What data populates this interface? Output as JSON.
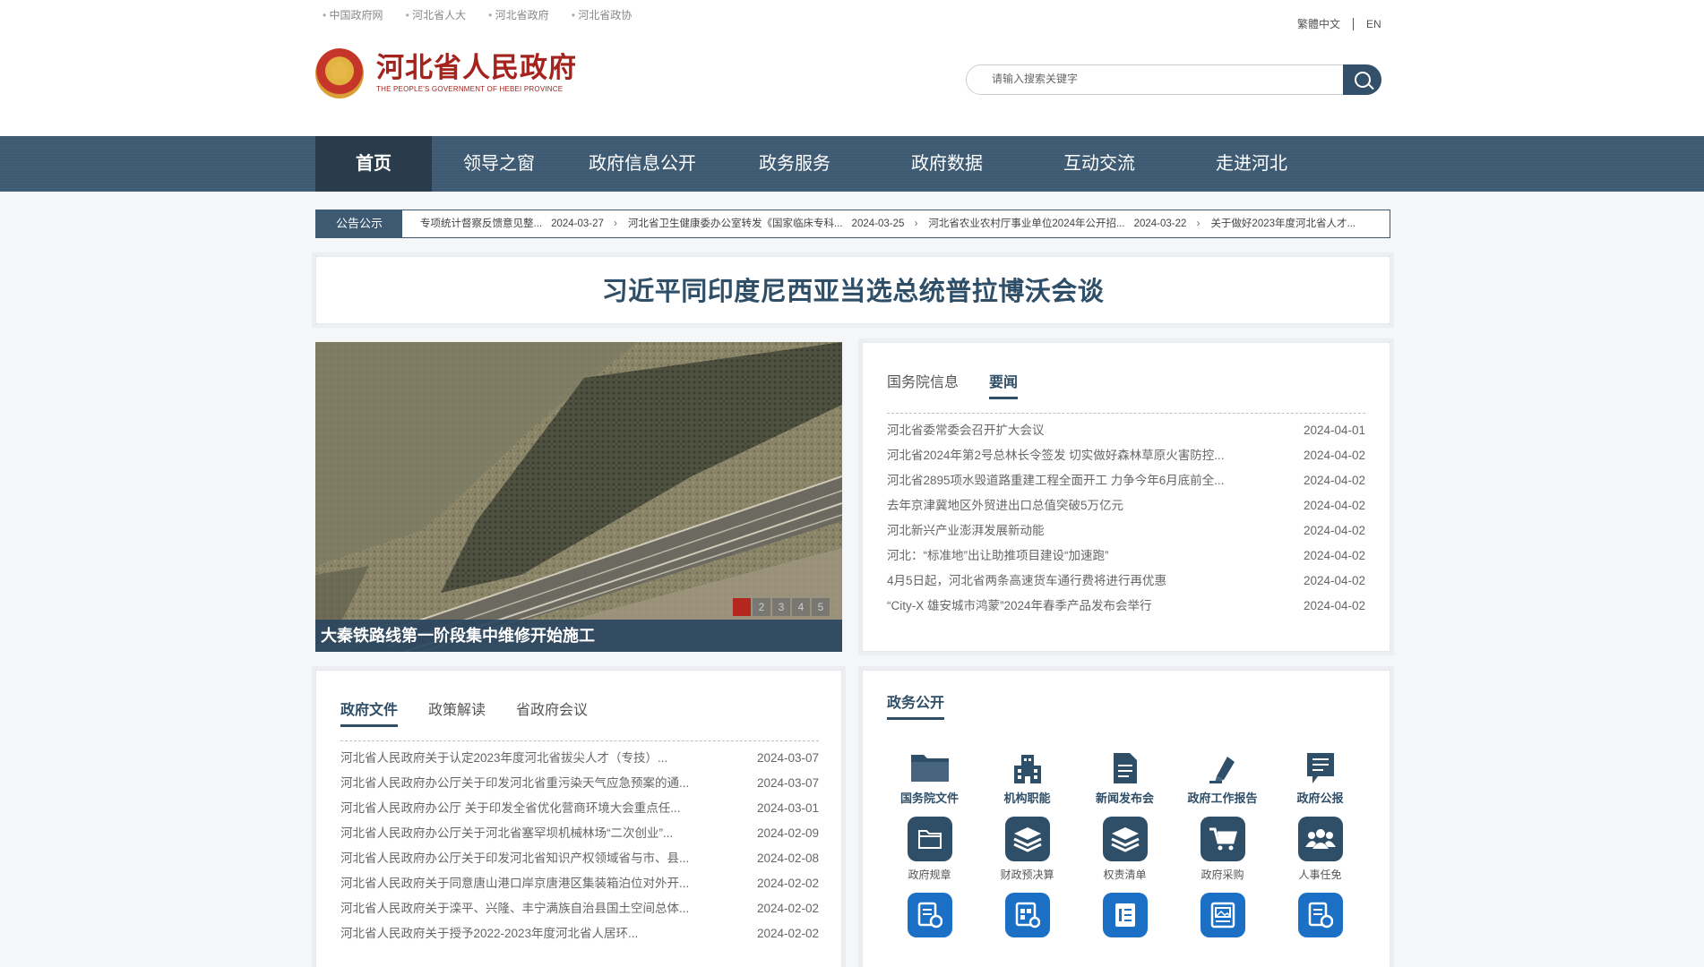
{
  "top_links": [
    "中国政府网",
    "河北省人大",
    "河北省政府",
    "河北省政协"
  ],
  "lang": {
    "traditional": "繁體中文",
    "english": "EN"
  },
  "logo": {
    "cn": "河北省人民政府",
    "en": "THE PEOPLE'S GOVERNMENT OF HEBEI PROVINCE"
  },
  "search": {
    "placeholder": "请输入搜索关键字"
  },
  "nav": [
    "首页",
    "领导之窗",
    "政府信息公开",
    "政务服务",
    "政府数据",
    "互动交流",
    "走进河北"
  ],
  "notice": {
    "label": "公告公示",
    "items": [
      {
        "title": "专项统计督察反馈意见整...",
        "date": "2024-03-27"
      },
      {
        "title": "河北省卫生健康委办公室转发《国家临床专科...",
        "date": "2024-03-25"
      },
      {
        "title": "河北省农业农村厅事业单位2024年公开招...",
        "date": "2024-03-22"
      },
      {
        "title": "关于做好2023年度河北省人才...",
        "date": ""
      }
    ]
  },
  "headline": "习近平同印度尼西亚当选总统普拉博沃会谈",
  "slider": {
    "caption": "大秦铁路线第一阶段集中维修开始施工",
    "pages": [
      "1",
      "2",
      "3",
      "4",
      "5"
    ]
  },
  "news": {
    "tabs": [
      "国务院信息",
      "要闻"
    ],
    "active_tab": "要闻",
    "items": [
      {
        "title": "河北省委常委会召开扩大会议",
        "date": "2024-04-01"
      },
      {
        "title": "河北省2024年第2号总林长令签发 切实做好森林草原火害防控...",
        "date": "2024-04-02"
      },
      {
        "title": "河北省2895项水毁道路重建工程全面开工 力争今年6月底前全...",
        "date": "2024-04-02"
      },
      {
        "title": "去年京津冀地区外贸进出口总值突破5万亿元",
        "date": "2024-04-02"
      },
      {
        "title": "河北新兴产业澎湃发展新动能",
        "date": "2024-04-02"
      },
      {
        "title": "河北：“标准地”出让助推项目建设“加速跑”",
        "date": "2024-04-02"
      },
      {
        "title": "4月5日起，河北省两条高速货车通行费将进行再优惠",
        "date": "2024-04-02"
      },
      {
        "title": "“City-X 雄安城市鸿蒙”2024年春季产品发布会举行",
        "date": "2024-04-02"
      }
    ]
  },
  "docs": {
    "tabs": [
      "政府文件",
      "政策解读",
      "省政府会议"
    ],
    "active_tab": "政府文件",
    "items": [
      {
        "title": "河北省人民政府关于认定2023年度河北省拔尖人才（专技）...",
        "date": "2024-03-07"
      },
      {
        "title": "河北省人民政府办公厅关于印发河北省重污染天气应急预案的通...",
        "date": "2024-03-07"
      },
      {
        "title": "河北省人民政府办公厅 关于印发全省优化营商环境大会重点任...",
        "date": "2024-03-01"
      },
      {
        "title": "河北省人民政府办公厅关于河北省塞罕坝机械林场“二次创业”...",
        "date": "2024-02-09"
      },
      {
        "title": "河北省人民政府办公厅关于印发河北省知识产权领域省与市、县...",
        "date": "2024-02-08"
      },
      {
        "title": "河北省人民政府关于同意唐山港口岸京唐港区集装箱泊位对外开...",
        "date": "2024-02-02"
      },
      {
        "title": "河北省人民政府关于滦平、兴隆、丰宁满族自治县国土空间总体...",
        "date": "2024-02-02"
      },
      {
        "title": "河北省人民政府关于授予2022-2023年度河北省人居环...",
        "date": "2024-02-02"
      }
    ]
  },
  "affairs": {
    "title": "政务公开",
    "row1": [
      {
        "label": "国务院文件",
        "icon": "folder-icon"
      },
      {
        "label": "机构职能",
        "icon": "building-icon"
      },
      {
        "label": "新闻发布会",
        "icon": "document-icon"
      },
      {
        "label": "政府工作报告",
        "icon": "pen-icon"
      },
      {
        "label": "政府公报",
        "icon": "bulletin-icon"
      }
    ],
    "row2": [
      {
        "label": "政府规章",
        "icon": "folder-icon"
      },
      {
        "label": "财政预决算",
        "icon": "layers-icon"
      },
      {
        "label": "权责清单",
        "icon": "layers-icon"
      },
      {
        "label": "政府采购",
        "icon": "cart-icon"
      },
      {
        "label": "人事任免",
        "icon": "people-icon"
      }
    ],
    "row3": [
      {
        "icon": "form-icon"
      },
      {
        "icon": "table-doc-icon"
      },
      {
        "icon": "doc-lines-icon"
      },
      {
        "icon": "image-doc-icon"
      },
      {
        "icon": "form-icon"
      }
    ]
  },
  "colors": {
    "primary": "#3d5a72",
    "dark": "#2a3c4b",
    "accent_red": "#a4231d",
    "blue_icon": "#1b6fc4"
  }
}
